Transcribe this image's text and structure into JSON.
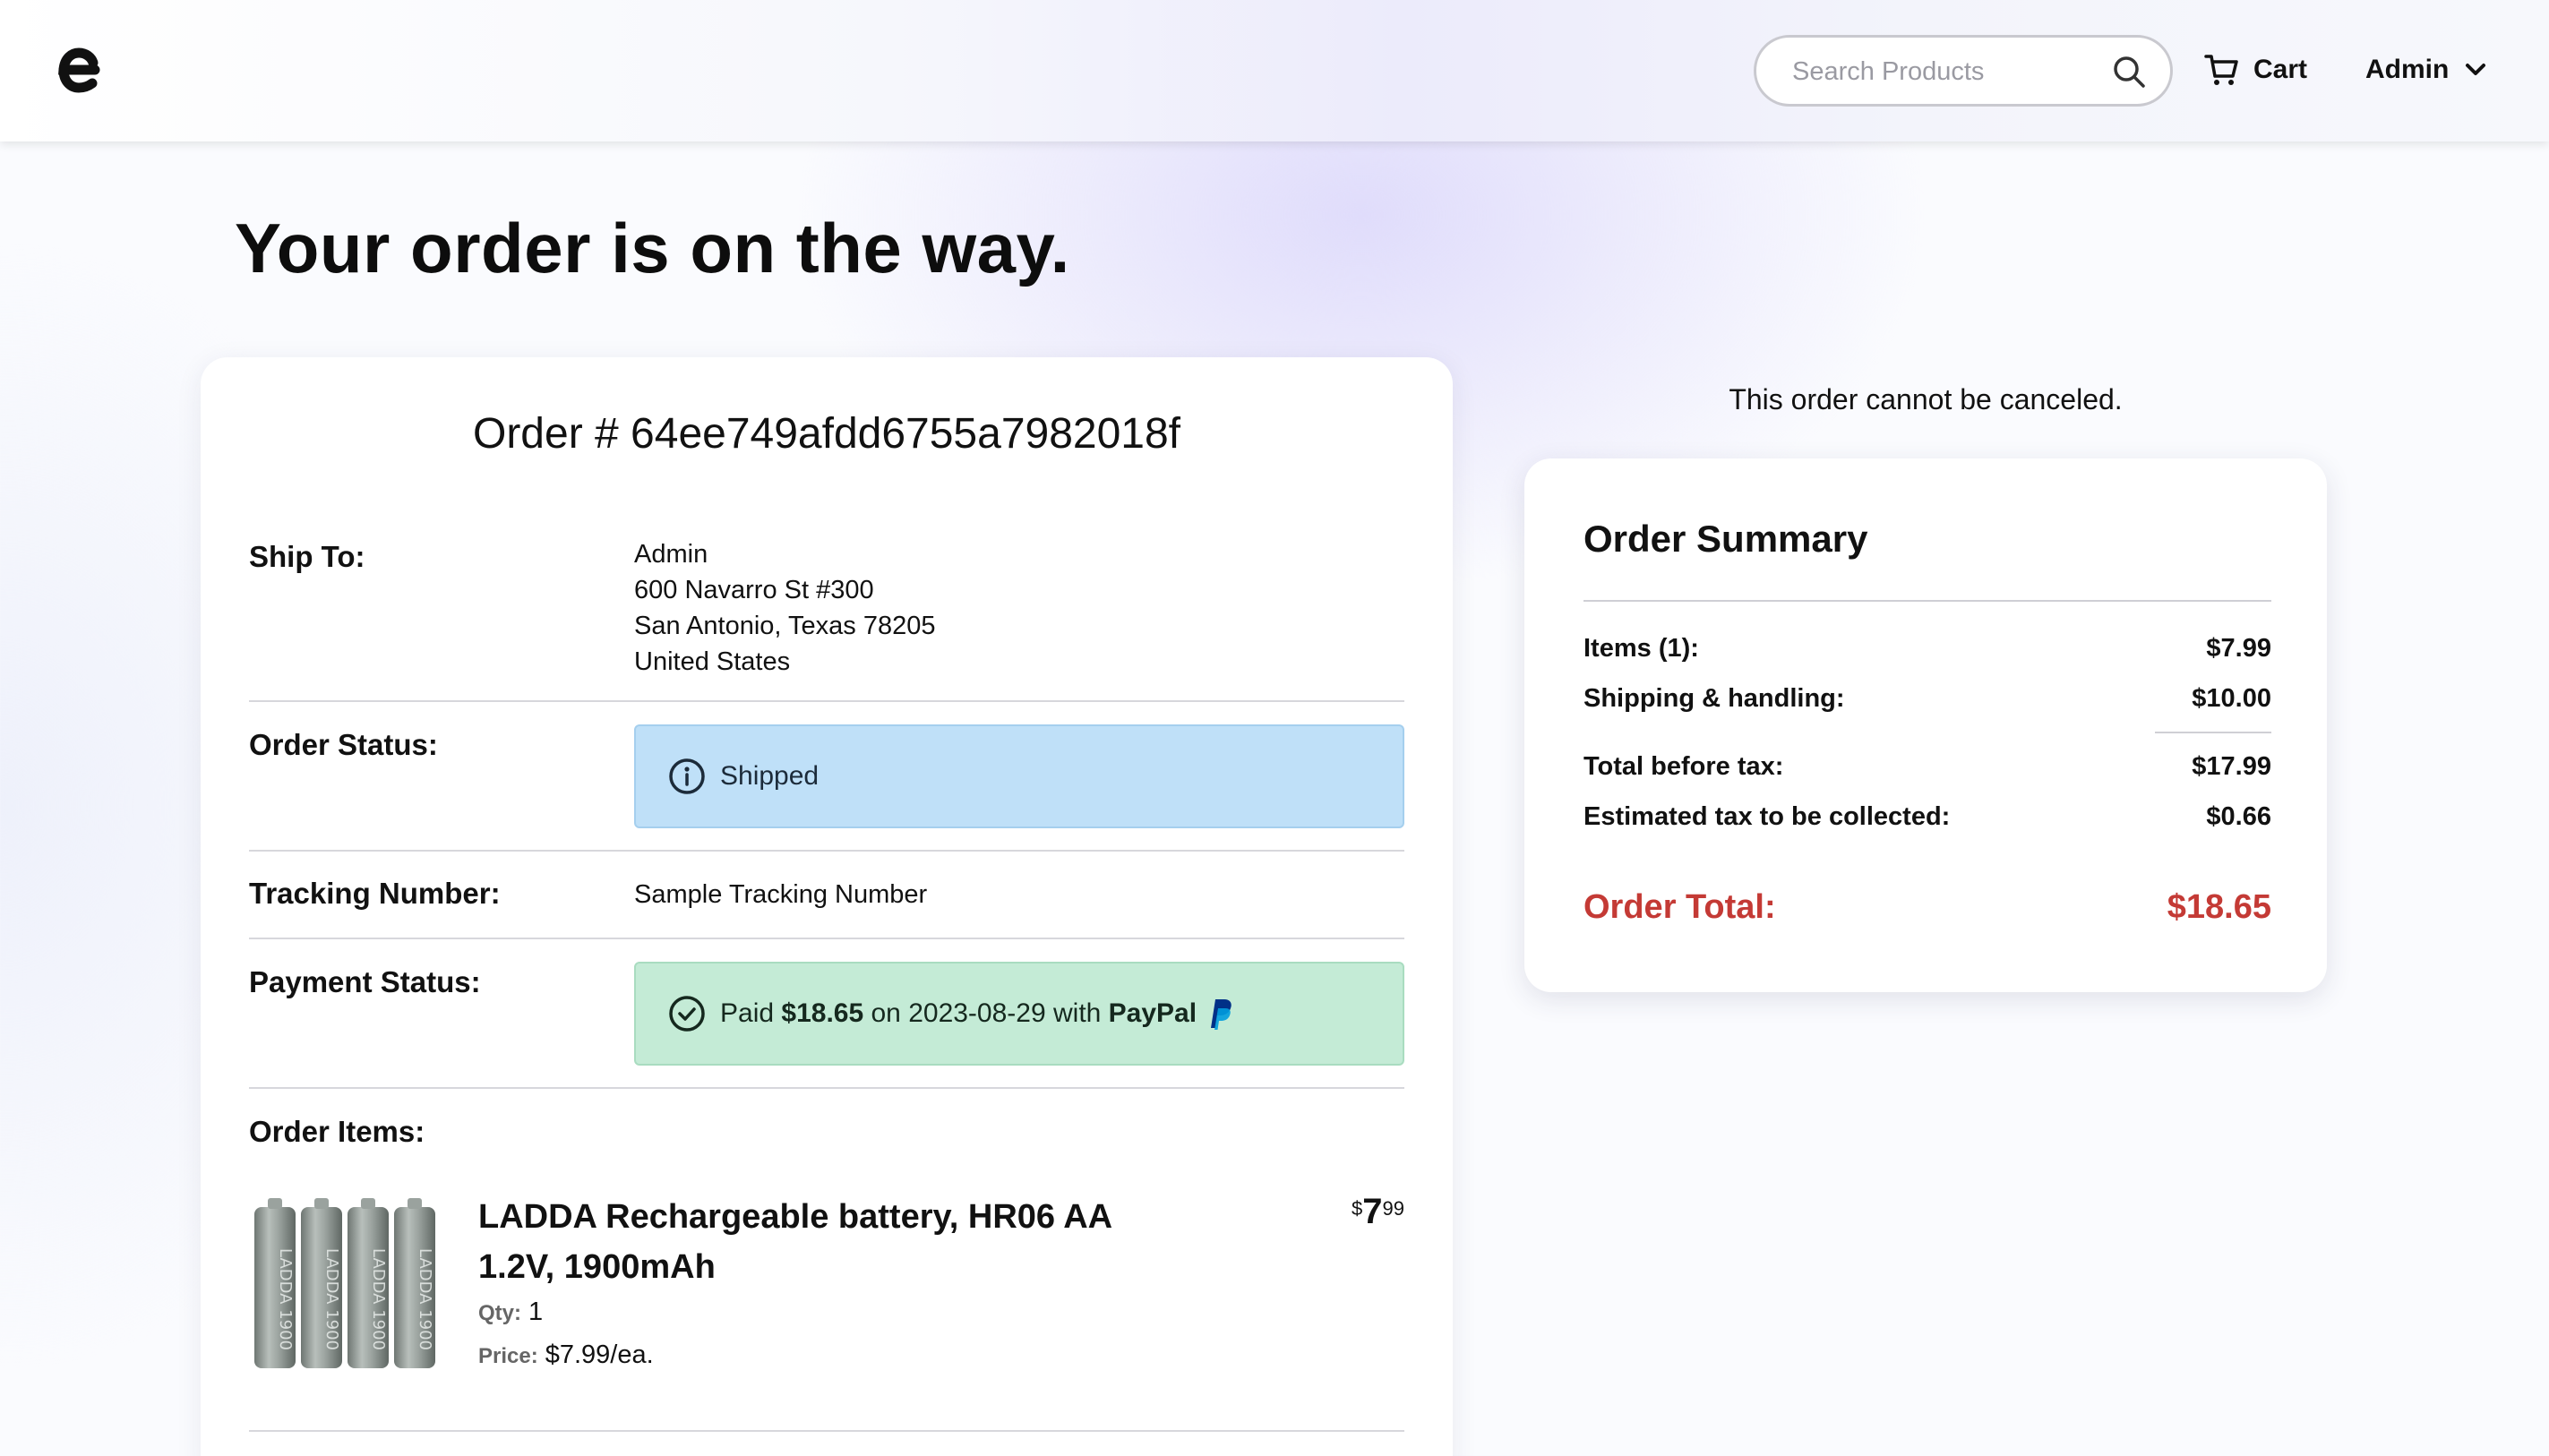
{
  "header": {
    "logo_icon": "brand-e-logo",
    "search": {
      "placeholder": "Search Products",
      "value": ""
    },
    "cart_label": "Cart",
    "user_label": "Admin"
  },
  "page_title": "Your order is on the way.",
  "order": {
    "number_text": "Order # 64ee749afdd6755a7982018f",
    "ship_to_label": "Ship To:",
    "address": {
      "name": "Admin",
      "street": "600 Navarro St #300",
      "city_line": "San Antonio, Texas 78205",
      "country": "United States"
    },
    "status_label": "Order Status:",
    "status_value": "Shipped",
    "tracking_label": "Tracking Number:",
    "tracking_value": "Sample Tracking Number",
    "payment_label": "Payment Status:",
    "payment": {
      "prefix": "Paid ",
      "amount": "$18.65",
      "middle": " on 2023-08-29 with ",
      "method": "PayPal"
    },
    "items_label": "Order Items:",
    "items": [
      {
        "name": "LADDA Rechargeable battery, HR06 AA 1.2V, 1900mAh",
        "qty_label": "Qty:",
        "qty": "1",
        "price_label": "Price:",
        "price_each": "$7.99/ea.",
        "price_currency": "$",
        "price_whole": "7",
        "price_fraction": "99",
        "image_text": "LADDA 1900"
      }
    ]
  },
  "cancel_note": "This order cannot be canceled.",
  "summary": {
    "title": "Order Summary",
    "rows": [
      {
        "label": "Items (1):",
        "value": "$7.99"
      },
      {
        "label": "Shipping & handling:",
        "value": "$10.00"
      },
      {
        "label": "Total before tax:",
        "value": "$17.99"
      },
      {
        "label": "Estimated tax to be collected:",
        "value": "$0.66"
      }
    ],
    "total_label": "Order Total:",
    "total_value": "$18.65"
  },
  "colors": {
    "status_info_bg": "#bfe0f8",
    "payment_success_bg": "#c4ebd6",
    "total_red": "#c43a35",
    "paypal_blue": "#003087",
    "paypal_light": "#009cde"
  }
}
